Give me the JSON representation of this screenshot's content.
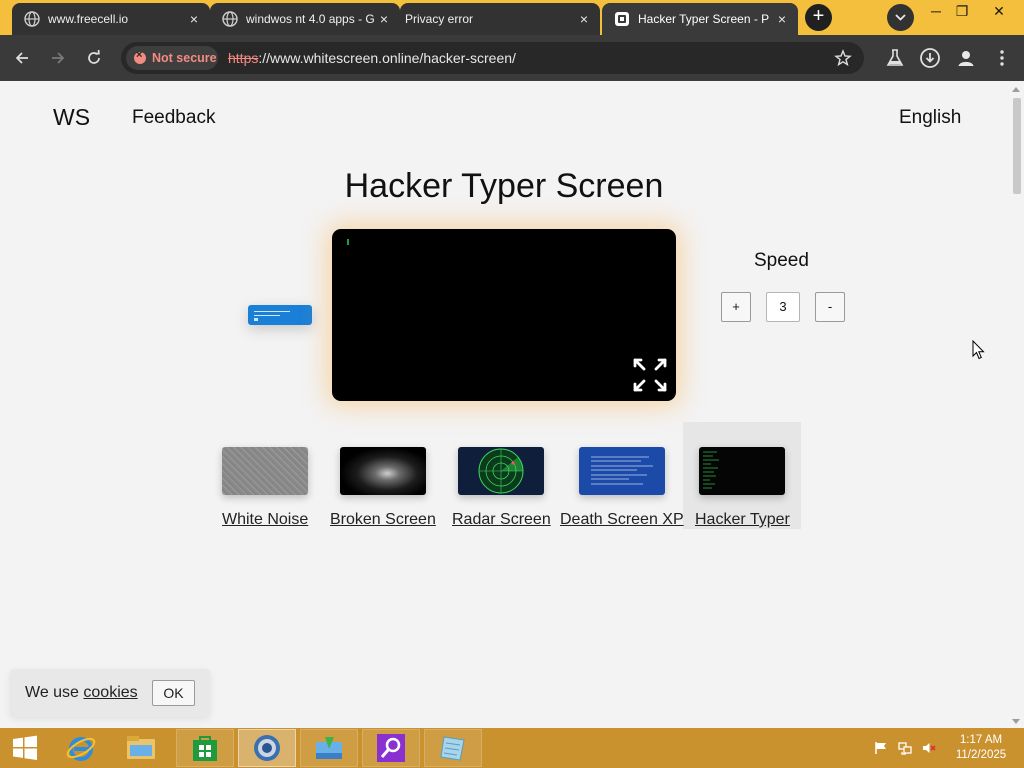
{
  "browser": {
    "tabs": [
      {
        "title": "www.freecell.io",
        "close": "×"
      },
      {
        "title": "windwos nt 4.0 apps - G",
        "close": "×"
      },
      {
        "title": "Privacy error",
        "close": "×"
      },
      {
        "title": "Hacker Typer Screen - P",
        "close": "×"
      }
    ],
    "new_tab": "+",
    "window_controls": {
      "minimize": "─",
      "restore": "❐",
      "close": "✕"
    },
    "security_label": "Not secure",
    "url_scheme": "https",
    "url_rest": "://www.whitescreen.online/hacker-screen/"
  },
  "page": {
    "logo": "WS",
    "feedback": "Feedback",
    "language": "English",
    "title": "Hacker Typer Screen",
    "speed": {
      "label": "Speed",
      "plus": "+",
      "value": "3",
      "minus": "-"
    },
    "thumbnails": [
      {
        "label": "White Noise"
      },
      {
        "label": "Broken Screen"
      },
      {
        "label": "Radar Screen"
      },
      {
        "label": "Death Screen XP"
      },
      {
        "label": "Hacker Typer"
      }
    ],
    "cookie": {
      "text": "We use ",
      "link": "cookies",
      "ok": "OK"
    }
  },
  "taskbar": {
    "time": "1:17 AM",
    "date": "11/2/2025"
  },
  "colors": {
    "taskbar": "#c9922f",
    "tabstrip": "#f4bf3d",
    "terminal_glow": "#ffaa3c",
    "insecure": "#f28b82",
    "chip_blue": "#1a7fd6"
  },
  "icons": [
    "globe-icon",
    "hacker-favicon-icon",
    "back-icon",
    "forward-icon",
    "reload-icon",
    "star-icon",
    "labs-icon",
    "download-icon",
    "profile-icon",
    "menu-icon",
    "fullscreen-icon",
    "start-icon",
    "ie-icon",
    "explorer-icon",
    "store-icon",
    "browser-icon",
    "file-transfer-icon",
    "search-app-icon",
    "notepad-icon",
    "flag-icon",
    "network-icon",
    "volume-muted-icon"
  ]
}
